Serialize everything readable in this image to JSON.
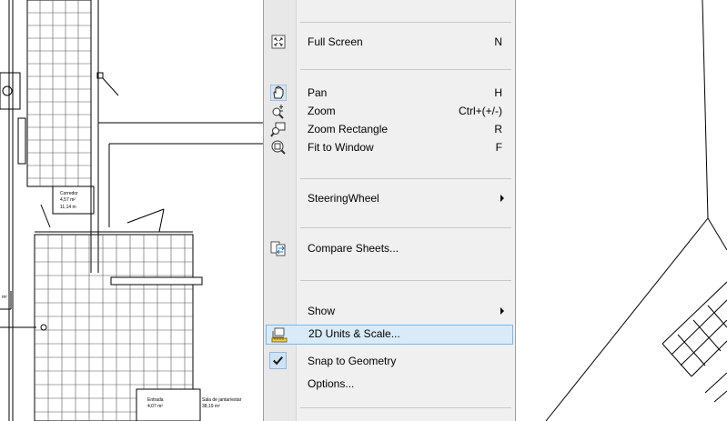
{
  "menu": {
    "items": [
      {
        "label": "Full Screen",
        "shortcut": "N",
        "icon": "full-screen-icon"
      },
      {
        "label": "Pan",
        "shortcut": "H",
        "icon": "hand-icon"
      },
      {
        "label": "Zoom",
        "shortcut": "Ctrl+(+/-)",
        "icon": "zoom-icon"
      },
      {
        "label": "Zoom Rectangle",
        "shortcut": "R",
        "icon": "zoom-rectangle-icon"
      },
      {
        "label": "Fit to Window",
        "shortcut": "F",
        "icon": "fit-to-window-icon"
      },
      {
        "label": "SteeringWheel",
        "submenu": true
      },
      {
        "label": "Compare Sheets...",
        "icon": "compare-sheets-icon"
      },
      {
        "label": "Show",
        "submenu": true
      },
      {
        "label": "2D Units & Scale...",
        "icon": "units-scale-icon",
        "highlighted": true
      },
      {
        "label": "Snap to Geometry",
        "icon": "check-icon",
        "checked": true
      },
      {
        "label": "Options..."
      }
    ]
  },
  "drawing": {
    "room_labels": [
      "Corredor",
      "4,57 m²",
      "11,14 m",
      "Entrada",
      "4,07 m²",
      "Sala de jantar/estar",
      "38,19 m²",
      "m²"
    ]
  },
  "colors": {
    "menu_bg": "#f0f0f0",
    "highlight_bg": "#d9ebf9",
    "highlight_border": "#7fb6e6"
  }
}
